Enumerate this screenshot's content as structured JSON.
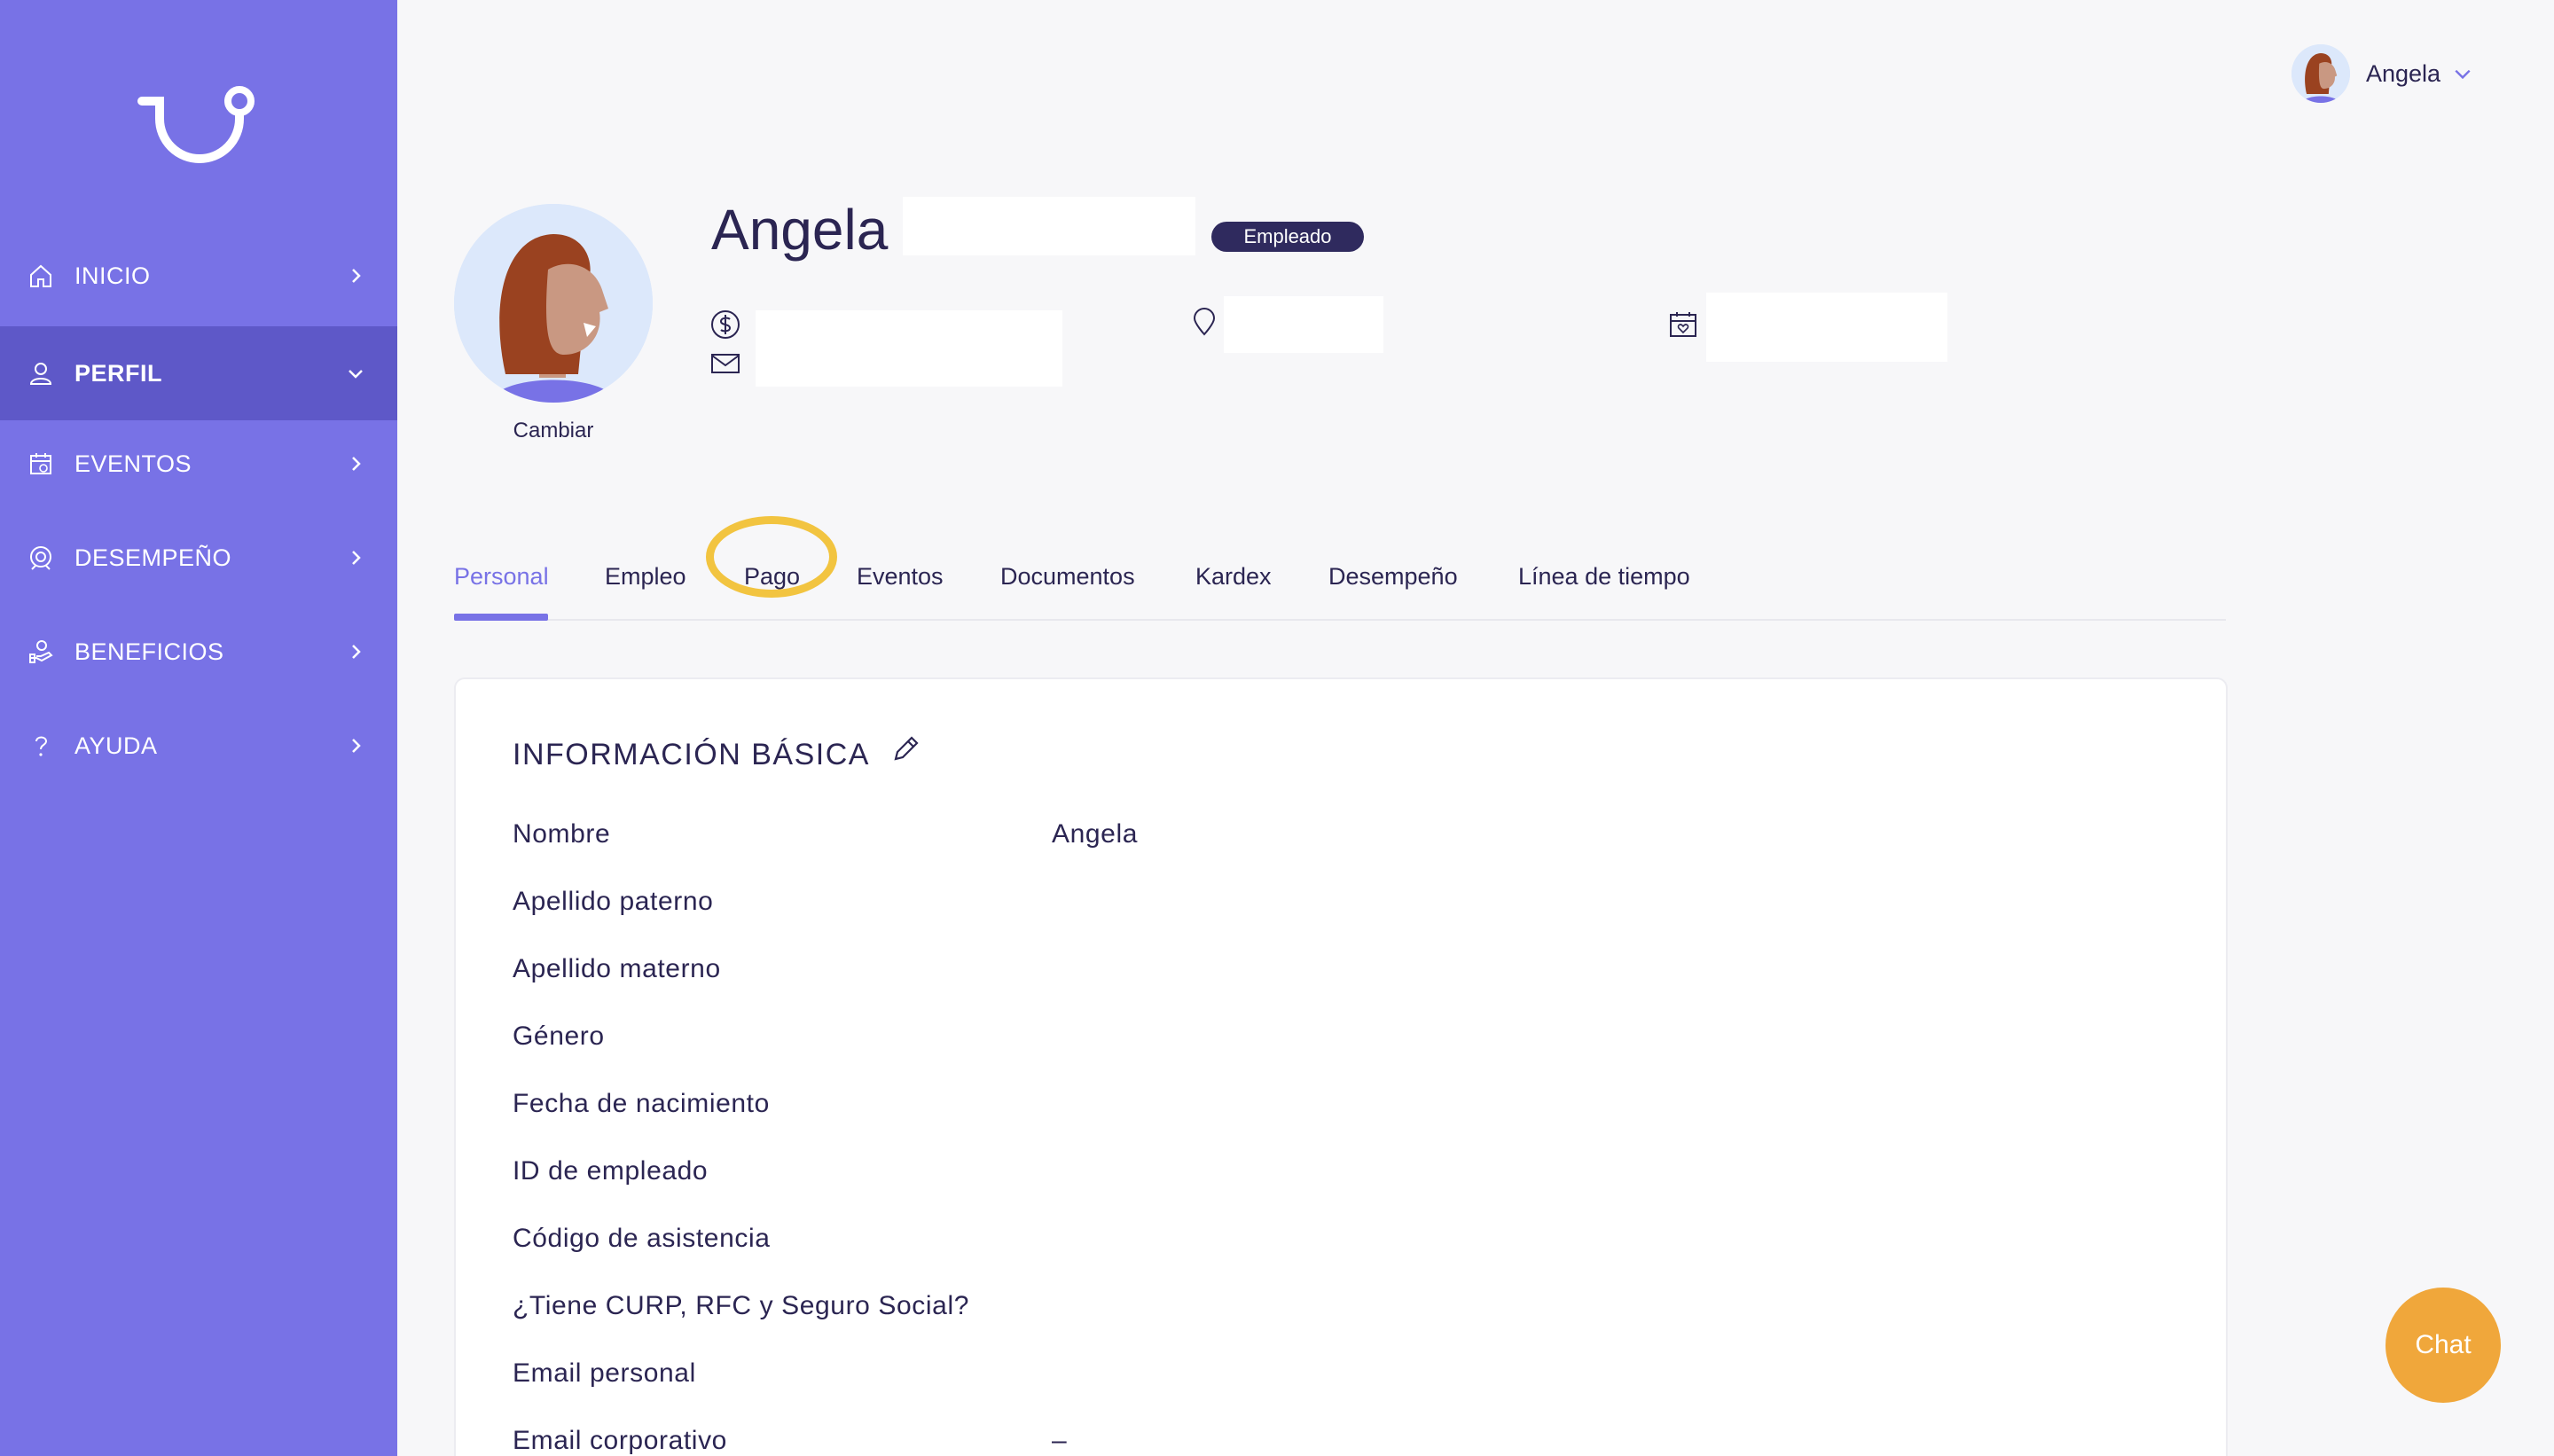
{
  "sidebar": {
    "items": [
      {
        "label": "INICIO",
        "icon": "home-icon"
      },
      {
        "label": "PERFIL",
        "icon": "user-icon",
        "active": true
      },
      {
        "label": "EVENTOS",
        "icon": "calendar-icon"
      },
      {
        "label": "DESEMPEÑO",
        "icon": "performance-icon"
      },
      {
        "label": "BENEFICIOS",
        "icon": "benefits-icon"
      },
      {
        "label": "AYUDA",
        "icon": "help-icon"
      }
    ]
  },
  "user_menu": {
    "name": "Angela"
  },
  "profile": {
    "first_name": "Angela",
    "badge": "Empleado",
    "change_avatar": "Cambiar"
  },
  "tabs": [
    "Personal",
    "Empleo",
    "Pago",
    "Eventos",
    "Documentos",
    "Kardex",
    "Desempeño",
    "Línea de tiempo"
  ],
  "active_tab": "Personal",
  "highlighted_tab": "Pago",
  "basic_info": {
    "title": "INFORMACIÓN BÁSICA",
    "rows": [
      {
        "label": "Nombre",
        "value": "Angela"
      },
      {
        "label": "Apellido paterno",
        "value": ""
      },
      {
        "label": "Apellido materno",
        "value": ""
      },
      {
        "label": "Género",
        "value": ""
      },
      {
        "label": "Fecha de nacimiento",
        "value": ""
      },
      {
        "label": "ID de empleado",
        "value": ""
      },
      {
        "label": "Código de asistencia",
        "value": ""
      },
      {
        "label": "¿Tiene CURP, RFC y Seguro Social?",
        "value": ""
      },
      {
        "label": "Email personal",
        "value": ""
      },
      {
        "label": "Email corporativo",
        "value": "–"
      }
    ]
  },
  "chat": {
    "label": "Chat"
  },
  "colors": {
    "sidebar": "#7872e6",
    "sidebar_active": "#5e58c8",
    "accent": "#7872e6",
    "badge": "#2f2a5e",
    "chat": "#f0a73b",
    "highlight": "#f2c440"
  }
}
